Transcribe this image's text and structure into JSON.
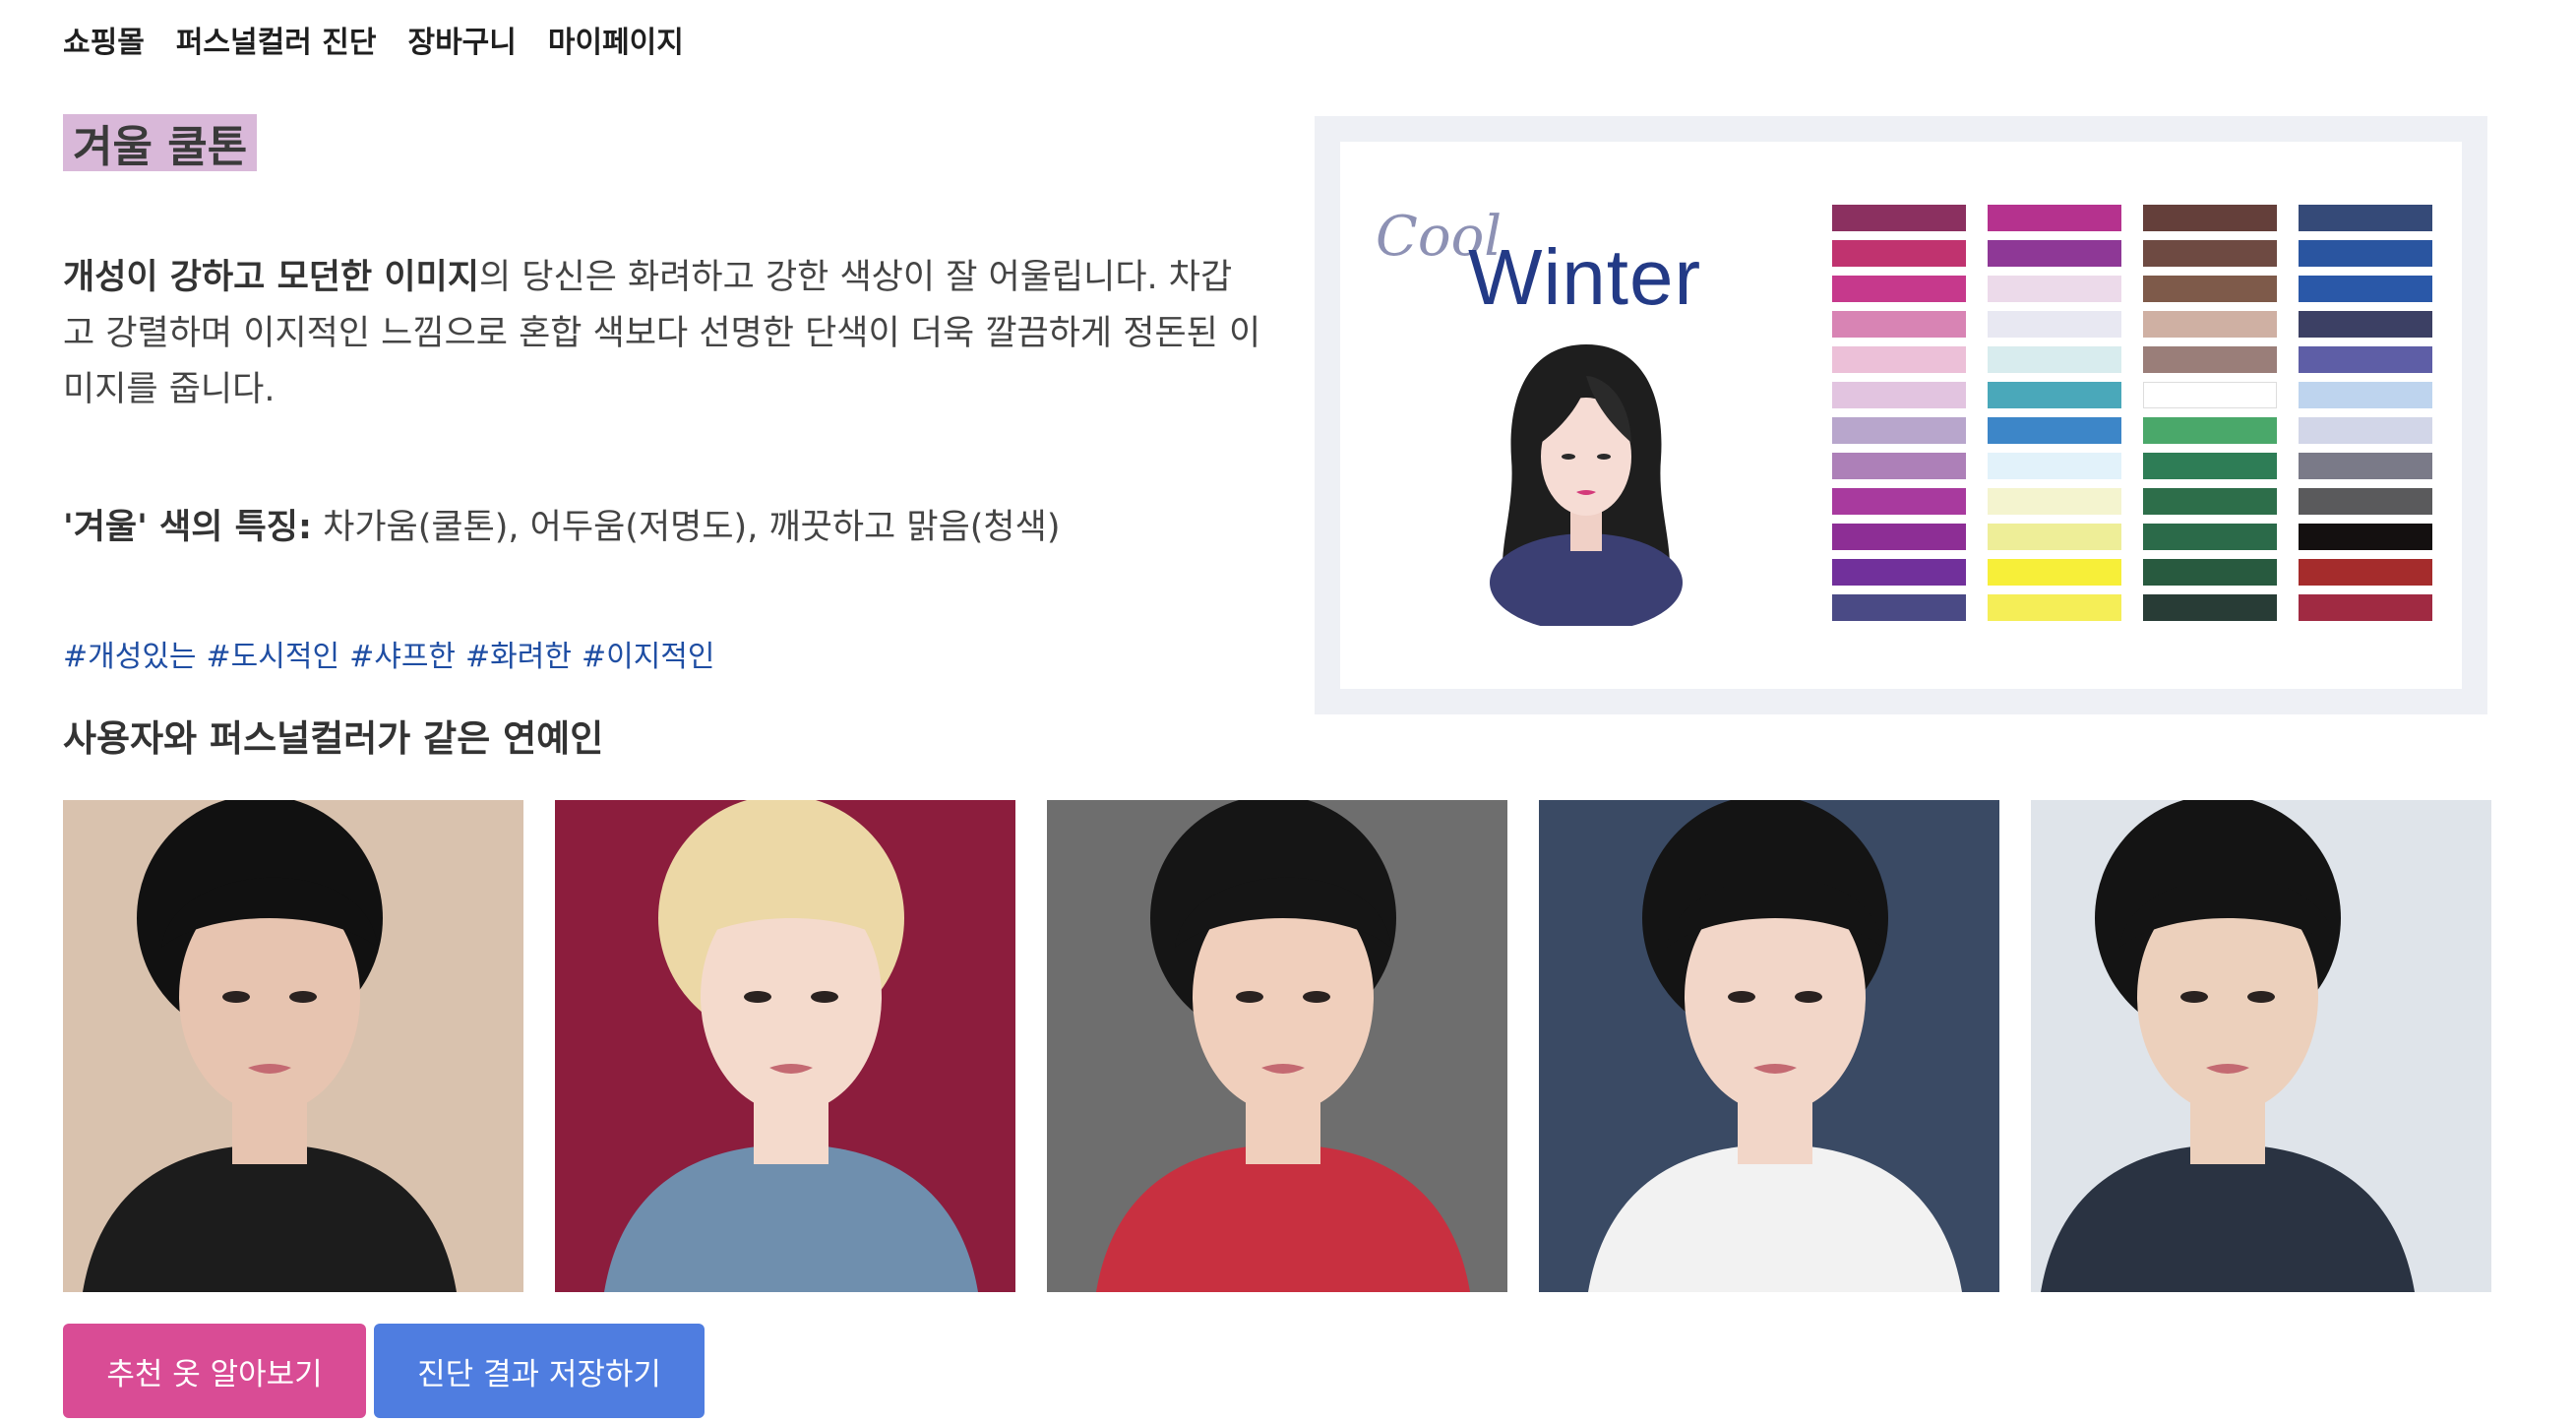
{
  "nav": {
    "items": [
      {
        "label": "쇼핑몰"
      },
      {
        "label": "퍼스널컬러 진단"
      },
      {
        "label": "장바구니"
      },
      {
        "label": "마이페이지"
      }
    ]
  },
  "result": {
    "title": "겨울 쿨톤",
    "desc_bold": "개성이 강하고 모던한 이미지",
    "desc_rest": "의 당신은 화려하고 강한 색상이 잘 어울립니다. 차갑고 강렬하며 이지적인 느낌으로 혼합 색보다 선명한 단색이 더욱 깔끔하게 정돈된 이미지를 줍니다.",
    "feature_label": "'겨울' 색의 특징:",
    "feature_text": " 차가움(쿨톤), 어두움(저명도), 깨끗하고 맑음(청색)",
    "tags": [
      "#개성있는",
      "#도시적인",
      "#샤프한",
      "#화려한",
      "#이지적인"
    ]
  },
  "palette": {
    "cool_text": "Cool",
    "winter_text": "Winter",
    "title_color": "#233a86",
    "columns": [
      [
        "#8b3060",
        "#c0336f",
        "#c6398c",
        "#d884b4",
        "#ecc0d8",
        "#e2c4e0",
        "#b8a6cc",
        "#ad80b8",
        "#a83a9e",
        "#8d2e95",
        "#71309b",
        "#4a4a85"
      ],
      [
        "#b5328e",
        "#8e3896",
        "#ecdaea",
        "#e8e8f2",
        "#d8ecee",
        "#4aa8ba",
        "#3d86c8",
        "#e2f2fa",
        "#f4f4cf",
        "#eeee98",
        "#f7ef39",
        "#f5ee57"
      ],
      [
        "#643f3a",
        "#6e4a42",
        "#7e5a4a",
        "#cfb0a3",
        "#9a7e79",
        "#ffffff",
        "#4aa86a",
        "#2e7d56",
        "#2d6e4a",
        "#2b6a49",
        "#285a3f",
        "#283c36"
      ],
      [
        "#354a78",
        "#2a55a0",
        "#2a58a8",
        "#3c4064",
        "#5e5ea6",
        "#bed4ee",
        "#d2d6e8",
        "#7a7a88",
        "#5a5a5c",
        "#141010",
        "#a52c2c",
        "#a02a42"
      ]
    ]
  },
  "celebs": {
    "section_title": "사용자와 퍼스널컬러가 같은 연예인",
    "photos": [
      {
        "bg": "#d9c2ae",
        "hair": "#111111",
        "skin": "#e7c4b0",
        "top": "#1c1c1c"
      },
      {
        "bg": "#8c1d3d",
        "hair": "#ecd8a6",
        "skin": "#f4dacc",
        "top": "#6f8fae"
      },
      {
        "bg": "#6e6e6e",
        "hair": "#151515",
        "skin": "#f0cfbc",
        "top": "#c83040"
      },
      {
        "bg": "#3a4a64",
        "hair": "#141414",
        "skin": "#f2d6c8",
        "top": "#f2f2f2"
      },
      {
        "bg": "#dfe4ea",
        "hair": "#141414",
        "skin": "#ecd0bc",
        "top": "#2a3342"
      }
    ]
  },
  "buttons": {
    "recommend": "추천 옷 알아보기",
    "save": "진단 결과 저장하기"
  }
}
